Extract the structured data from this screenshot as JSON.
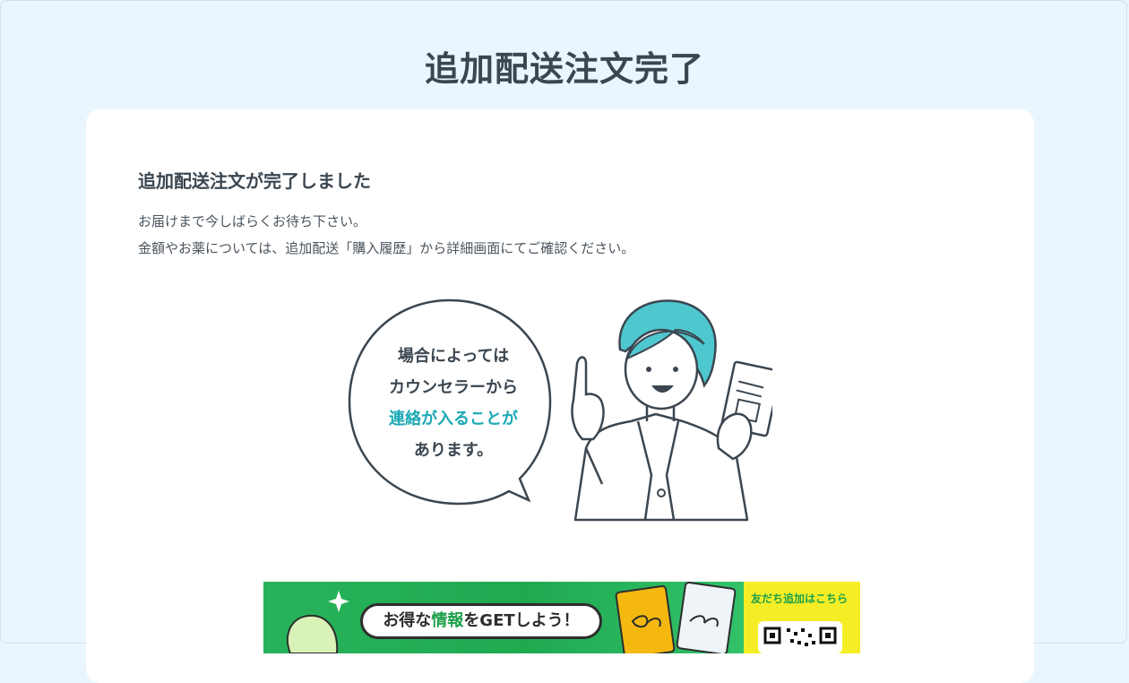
{
  "page": {
    "title": "追加配送注文完了"
  },
  "content": {
    "heading": "追加配送注文が完了しました",
    "lines": [
      "お届けまで今しばらくお待ち下さい。",
      "金額やお薬については、追加配送「購入履歴」から詳細画面にてご確認ください。"
    ]
  },
  "illustration": {
    "bubble_lines": [
      "場合によっては",
      "カウンセラーから"
    ],
    "bubble_accent": "連絡が入ることが",
    "bubble_last": "あります。"
  },
  "banner": {
    "pill_text_1": "お得な",
    "pill_text_2": "情報",
    "pill_text_3": "をGETしよう！",
    "side_label": "友だち追加はこちら"
  },
  "colors": {
    "background": "#eaf6fd",
    "accent": "#1aa9b5",
    "banner_green": "#27b35a",
    "banner_yellow": "#f5ee26"
  }
}
